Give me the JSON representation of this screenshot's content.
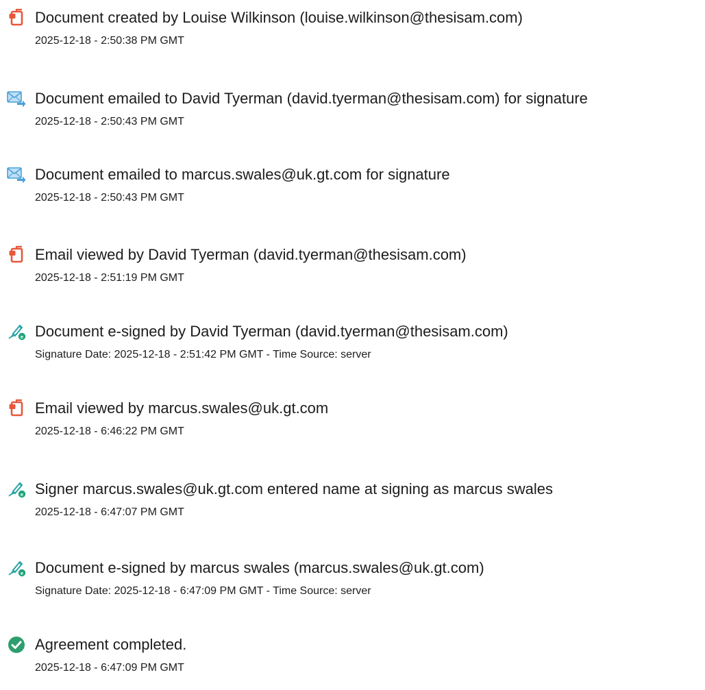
{
  "events": [
    {
      "icon": "document-icon",
      "title": "Document created by Louise Wilkinson (louise.wilkinson@thesisam.com)",
      "detail": "2025-12-18 - 2:50:38 PM GMT"
    },
    {
      "icon": "email-sent-icon",
      "title": "Document emailed to David Tyerman (david.tyerman@thesisam.com) for signature",
      "detail": "2025-12-18 - 2:50:43 PM GMT"
    },
    {
      "icon": "email-sent-icon",
      "title": "Document emailed to marcus.swales@uk.gt.com for signature",
      "detail": "2025-12-18 - 2:50:43 PM GMT"
    },
    {
      "icon": "document-icon",
      "title": "Email viewed by David Tyerman (david.tyerman@thesisam.com)",
      "detail": "2025-12-18 - 2:51:19 PM GMT"
    },
    {
      "icon": "e-sign-pen-icon",
      "title": "Document e-signed by David Tyerman (david.tyerman@thesisam.com)",
      "detail": "Signature Date: 2025-12-18 - 2:51:42 PM GMT - Time Source: server"
    },
    {
      "icon": "document-icon",
      "title": "Email viewed by marcus.swales@uk.gt.com",
      "detail": "2025-12-18 - 6:46:22 PM GMT"
    },
    {
      "icon": "e-sign-pen-icon",
      "title": "Signer marcus.swales@uk.gt.com entered name at signing as marcus swales",
      "detail": "2025-12-18 - 6:47:07 PM GMT"
    },
    {
      "icon": "e-sign-pen-icon",
      "title": "Document e-signed by marcus swales (marcus.swales@uk.gt.com)",
      "detail": "Signature Date: 2025-12-18 - 6:47:09 PM GMT - Time Source: server"
    },
    {
      "icon": "check-circle-icon",
      "title": "Agreement completed.",
      "detail": "2025-12-18 - 6:47:09 PM GMT"
    }
  ],
  "colors": {
    "document_orange": "#E8573A",
    "email_blue": "#4A9FD8",
    "email_light": "#BFE0F5",
    "esign_teal": "#2BA3A5",
    "esign_green": "#1FA37A",
    "check_green": "#2F9E6F",
    "text": "#1C1C1C"
  }
}
